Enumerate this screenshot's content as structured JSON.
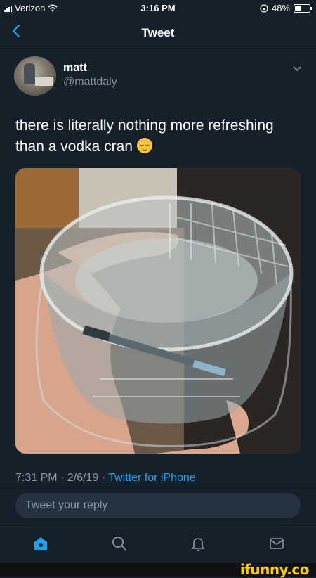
{
  "status_bar": {
    "carrier": "Verizon",
    "time": "3:16 PM",
    "battery": "48%",
    "battery_level": 0.48
  },
  "nav": {
    "title": "Tweet",
    "back_icon": "chevron-left-icon"
  },
  "tweet": {
    "display_name": "matt",
    "handle": "@mattdaly",
    "text": "there is literally nothing more refreshing than a vodka cran",
    "emoji": "relieved-face",
    "timestamp": "7:31 PM · 2/6/19 · ",
    "source": "Twitter for iPhone"
  },
  "reply": {
    "placeholder": "Tweet your reply"
  },
  "tabbar": {
    "items": [
      "home-icon",
      "search-icon",
      "notifications-icon",
      "messages-icon"
    ]
  },
  "watermark": "ifunny.co",
  "colors": {
    "background": "#15202b",
    "accent": "#1da1f2",
    "secondary_text": "#8899a6",
    "divider": "#38444d"
  }
}
